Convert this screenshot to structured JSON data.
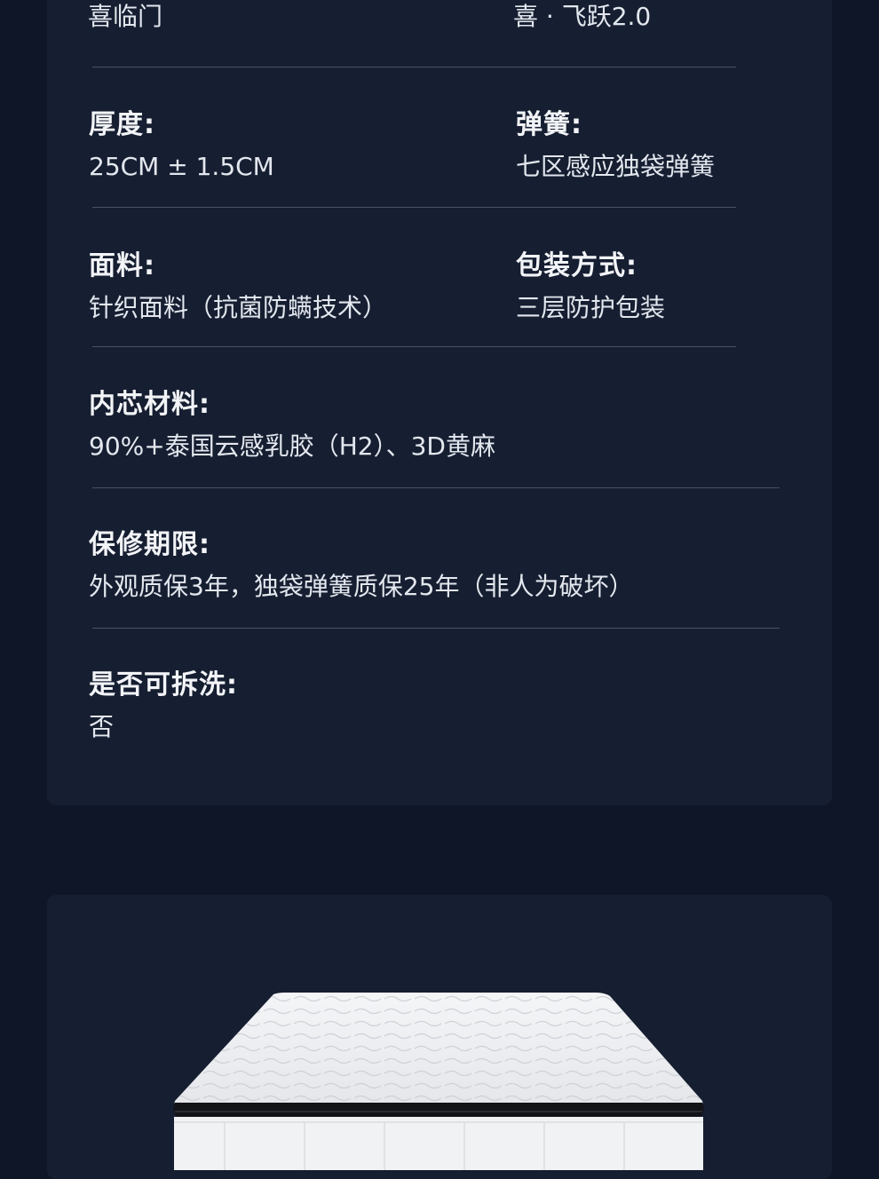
{
  "specs": {
    "series": {
      "value": "喜临门"
    },
    "name": {
      "value": "喜 · 飞跃2.0"
    },
    "thickness": {
      "label": "厚度:",
      "value": "25CM ± 1.5CM"
    },
    "spring": {
      "label": "弹簧:",
      "value": "七区感应独袋弹簧"
    },
    "fabric": {
      "label": "面料:",
      "value": "针织面料（抗菌防螨技术）"
    },
    "packaging": {
      "label": "包装方式:",
      "value": "三层防护包装"
    },
    "core": {
      "label": "内芯材料:",
      "value": "90%+泰国云感乳胶（H2）、3D黄麻"
    },
    "warranty": {
      "label": "保修期限:",
      "value": "外观质保3年，独袋弹簧质保25年（非人为破坏）"
    },
    "washable": {
      "label": "是否可拆洗:",
      "value": "否"
    }
  },
  "colors": {
    "background": "#0e1627",
    "card": "#161e31",
    "divider": "#4a5265"
  },
  "icons": {
    "product_image": "mattress-image"
  }
}
